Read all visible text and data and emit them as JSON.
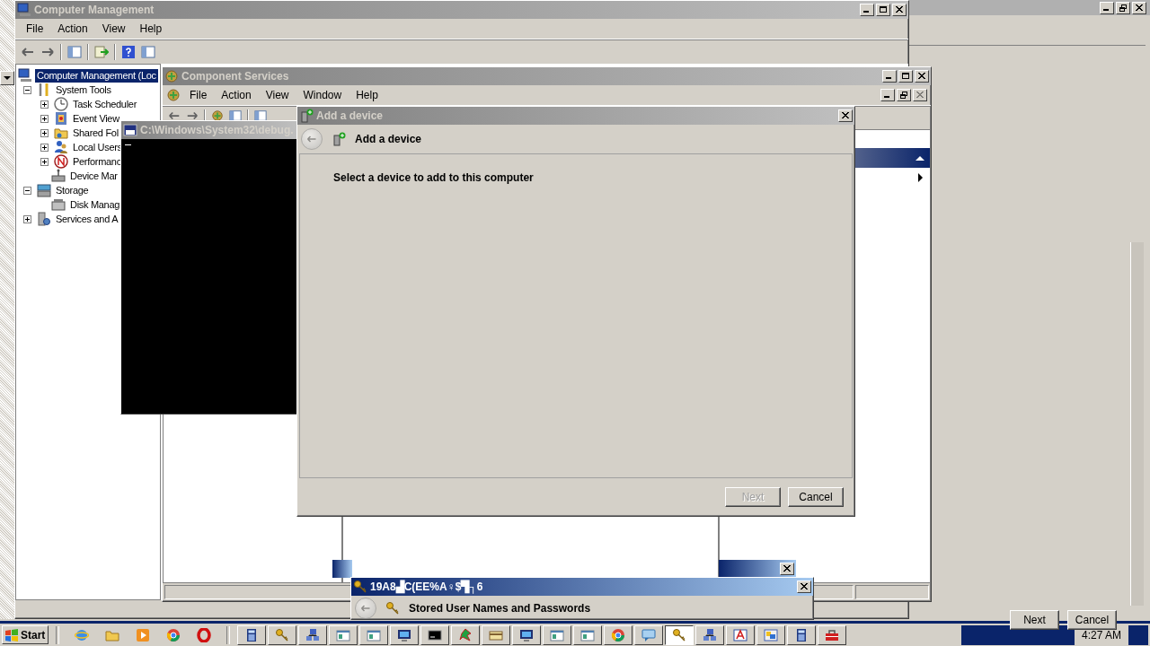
{
  "background_window": {
    "buttons": [
      {
        "label": "Next"
      },
      {
        "label": "Cancel"
      }
    ]
  },
  "computer_management": {
    "title": "Computer Management",
    "menu": [
      "File",
      "Action",
      "View",
      "Help"
    ],
    "tree": [
      {
        "label": "Computer Management (Loc",
        "selected": true,
        "children": [
          {
            "label": "System Tools",
            "expanded": true,
            "children": [
              {
                "label": "Task Scheduler",
                "expanded": false
              },
              {
                "label": "Event View",
                "expanded": false
              },
              {
                "label": "Shared Fol",
                "expanded": false
              },
              {
                "label": "Local Users",
                "expanded": false
              },
              {
                "label": "Performanc",
                "expanded": false
              },
              {
                "label": "Device Mar"
              }
            ]
          },
          {
            "label": "Storage",
            "expanded": true,
            "children": [
              {
                "label": "Disk Manag"
              }
            ]
          },
          {
            "label": "Services and A",
            "expanded": false
          }
        ]
      }
    ]
  },
  "component_services": {
    "title": "Component Services",
    "menu": [
      "File",
      "Action",
      "View",
      "Window",
      "Help"
    ]
  },
  "console_window": {
    "title": "C:\\Windows\\System32\\debug."
  },
  "add_device_dialog": {
    "title": "Add a device",
    "heading": "Add a device",
    "instruction": "Select a device to add to this computer",
    "buttons": [
      {
        "label": "Next",
        "disabled": true
      },
      {
        "label": "Cancel",
        "disabled": false
      }
    ]
  },
  "credentials_dialog": {
    "title": "19A8▟C(EE%A♀$▜┐6",
    "heading": "Stored User Names and Passwords"
  },
  "taskbar": {
    "start": "Start",
    "quick_launch": [
      {
        "kind": "globe"
      },
      {
        "kind": "folder"
      },
      {
        "kind": "media"
      },
      {
        "kind": "browser"
      },
      {
        "kind": "ring"
      }
    ],
    "tasks": [
      {
        "kind": "calculator",
        "selected": false
      },
      {
        "kind": "key",
        "selected": false
      },
      {
        "kind": "network",
        "selected": false
      },
      {
        "kind": "window",
        "selected": false
      },
      {
        "kind": "window",
        "selected": false
      },
      {
        "kind": "monitor",
        "selected": false
      },
      {
        "kind": "console",
        "selected": false
      },
      {
        "kind": "app",
        "selected": false
      },
      {
        "kind": "card",
        "selected": false
      },
      {
        "kind": "monitor",
        "selected": false
      },
      {
        "kind": "window",
        "selected": false
      },
      {
        "kind": "window",
        "selected": false
      },
      {
        "kind": "browser",
        "selected": false
      },
      {
        "kind": "chat",
        "selected": false
      },
      {
        "kind": "key",
        "selected": true
      },
      {
        "kind": "network",
        "selected": false
      },
      {
        "kind": "font",
        "selected": false
      },
      {
        "kind": "picture",
        "selected": false
      },
      {
        "kind": "calculator",
        "selected": false
      },
      {
        "kind": "toolbox",
        "selected": false
      }
    ],
    "clock": "4:27 AM"
  }
}
